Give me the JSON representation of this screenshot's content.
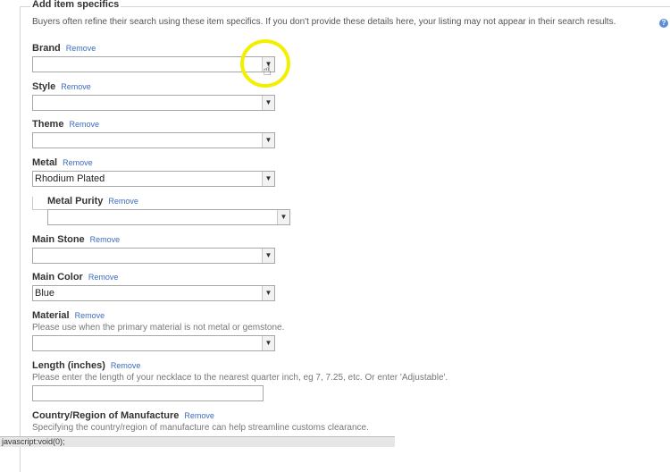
{
  "section": {
    "legend": "Add item specifics",
    "intro": "Buyers often refine their search using these item specifics. If you don't provide these details here, your listing may not appear in their search results.",
    "help_icon": "question-icon"
  },
  "remove_label": "Remove",
  "fields": {
    "brand": {
      "label": "Brand",
      "value": ""
    },
    "style": {
      "label": "Style",
      "value": ""
    },
    "theme": {
      "label": "Theme",
      "value": ""
    },
    "metal": {
      "label": "Metal",
      "value": "Rhodium Plated"
    },
    "metal_purity": {
      "label": "Metal Purity",
      "value": ""
    },
    "main_stone": {
      "label": "Main Stone",
      "value": ""
    },
    "main_color": {
      "label": "Main Color",
      "value": "Blue"
    },
    "material": {
      "label": "Material",
      "hint": "Please use when the primary material is not metal or gemstone.",
      "value": ""
    },
    "length": {
      "label": "Length (inches)",
      "hint": "Please enter the length of your necklace to the nearest quarter inch, eg 7, 7.25, etc. Or enter 'Adjustable'.",
      "value": ""
    },
    "country": {
      "label": "Country/Region of Manufacture",
      "hint": "Specifying the country/region of manufacture can help streamline customs clearance.",
      "value": ""
    }
  },
  "statusbar": {
    "text": "javascript:void(0);"
  },
  "colors": {
    "highlight": "#f2f000",
    "link": "#3c6bbf"
  }
}
